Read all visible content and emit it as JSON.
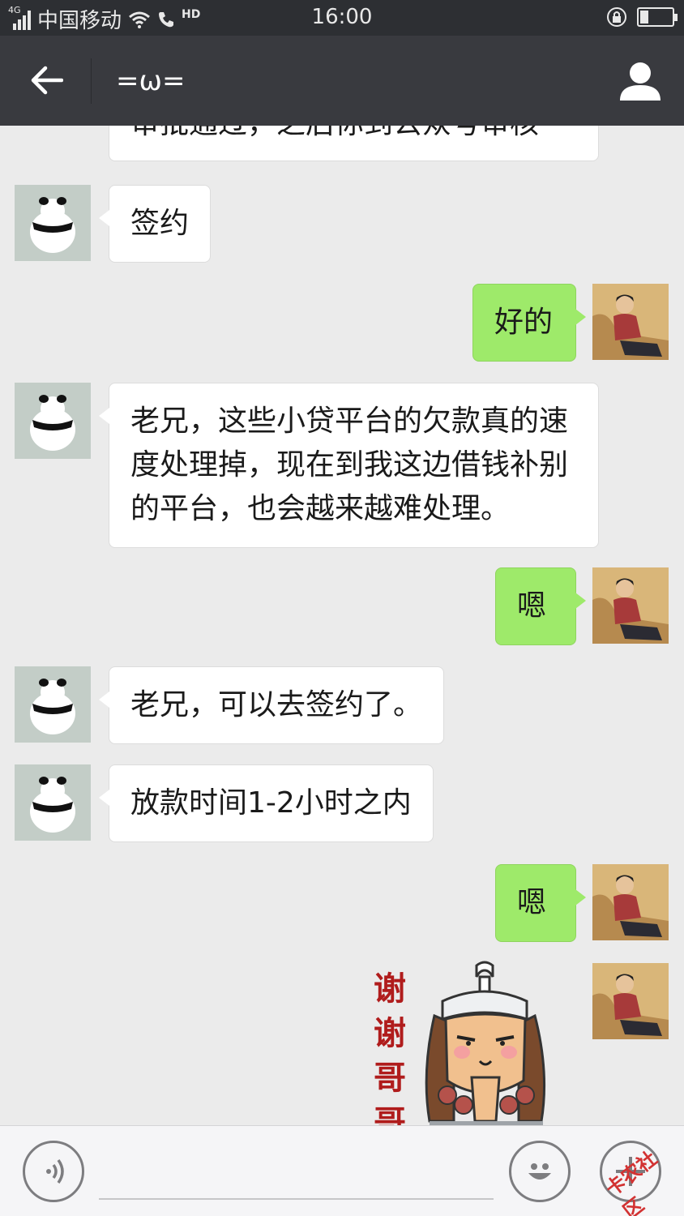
{
  "status_bar": {
    "network": "4G",
    "carrier": "中国移动",
    "hd": "HD",
    "time": "16:00"
  },
  "header": {
    "title": "=ω="
  },
  "messages": [
    {
      "side": "in",
      "text": "审批通过，之后你到公众号审核"
    },
    {
      "side": "in",
      "text": "签约"
    },
    {
      "side": "out",
      "text": "好的"
    },
    {
      "side": "in",
      "lines": [
        "老兄，这些小贷平台的欠款真的速",
        "度处理掉，现在到我这边借钱补别",
        "的平台，也会越来越难处理。"
      ]
    },
    {
      "side": "out",
      "text": "嗯"
    },
    {
      "side": "in",
      "text": "老兄，可以去签约了。"
    },
    {
      "side": "in",
      "text": "放款时间1-2小时之内"
    },
    {
      "side": "out",
      "text": "嗯"
    },
    {
      "side": "out",
      "type": "sticker",
      "caption": [
        "谢",
        "谢",
        "哥",
        "哥"
      ]
    }
  ],
  "watermark": "卡农社区",
  "colors": {
    "outgoing_bubble": "#9eea6a",
    "incoming_bubble": "#ffffff",
    "header_bg": "#393a3f",
    "chat_bg": "#ebebeb"
  },
  "icons": {
    "back": "arrow-left-icon",
    "profile": "person-icon",
    "voice": "voice-icon",
    "emoji": "smiley-icon",
    "more": "plus-icon"
  }
}
